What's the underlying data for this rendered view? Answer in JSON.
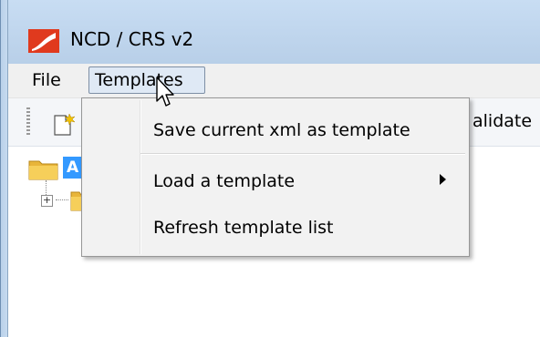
{
  "window": {
    "title": "NCD / CRS v2"
  },
  "menubar": {
    "file_label": "File",
    "templates_label": "Templates"
  },
  "toolbar": {
    "validate_label": "alidate"
  },
  "tree": {
    "selected_node_label": "A"
  },
  "templates_menu": {
    "items": [
      {
        "label": "Save current xml as template"
      },
      {
        "label": "Load a template",
        "has_submenu": true
      },
      {
        "label": "Refresh template list"
      }
    ]
  },
  "colors": {
    "titlebar": "#c1d6ee",
    "selection": "#3399ff",
    "logo_red": "#e03a1e"
  },
  "icons": {
    "app_logo": "app-logo-icon",
    "new_document": "new-document-icon",
    "folder": "folder-icon",
    "expand": "plus-box-icon",
    "submenu": "triangle-right-icon",
    "cursor": "mouse-pointer-icon"
  }
}
